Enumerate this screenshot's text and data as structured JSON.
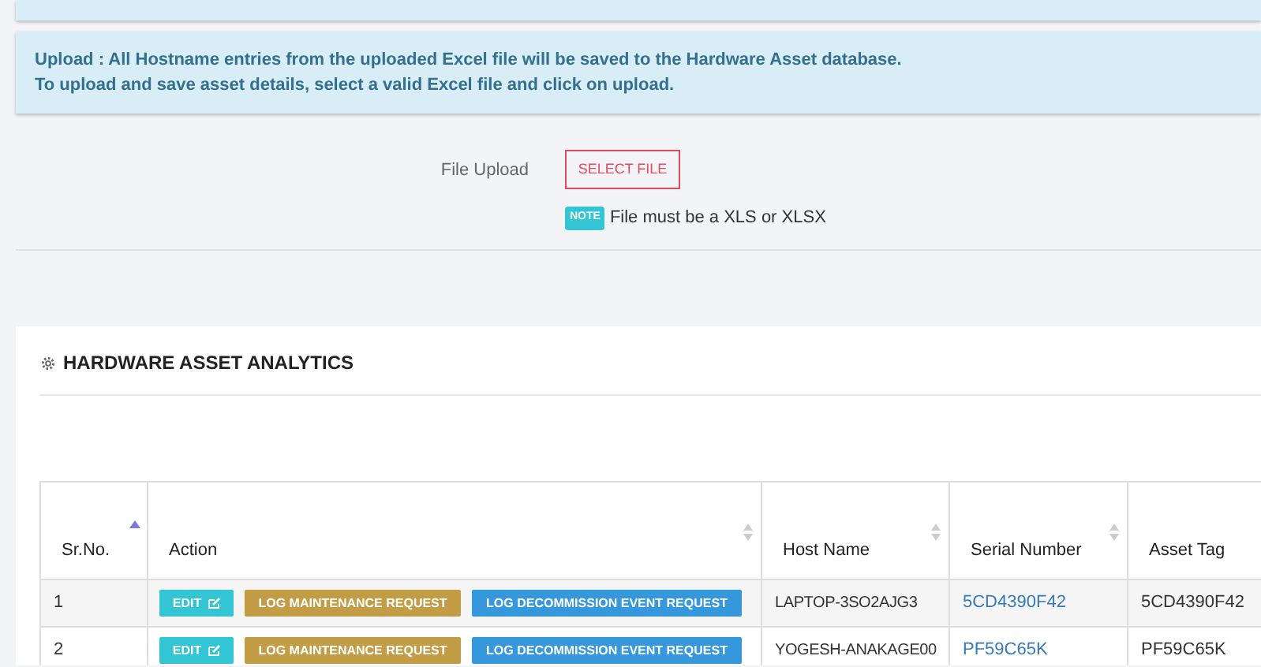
{
  "info": {
    "lines": [
      "Upload : All Hostname entries from the uploaded Excel file will be saved to the Hardware Asset database.",
      "To upload and save asset details, select a valid Excel file and click on upload."
    ]
  },
  "upload": {
    "label": "File Upload",
    "button": "SELECT FILE",
    "note_badge": "NOTE",
    "note": "File must be a XLS or XLSX"
  },
  "card": {
    "title": "HARDWARE ASSET ANALYTICS"
  },
  "table": {
    "columns": [
      {
        "label": "Sr.No.",
        "sorted": true
      },
      {
        "label": "Action",
        "sorted": false
      },
      {
        "label": "Host Name",
        "sorted": false
      },
      {
        "label": "Serial Number",
        "sorted": false
      },
      {
        "label": "Asset Tag"
      }
    ],
    "rows": [
      {
        "sr": "1",
        "actions": [
          {
            "kind": "edit",
            "label": "EDIT"
          },
          {
            "kind": "maintenance",
            "label": "LOG MAINTENANCE REQUEST"
          },
          {
            "kind": "decommission",
            "label": "LOG DECOMMISSION EVENT REQUEST"
          }
        ],
        "host": "LAPTOP-3SO2AJG3",
        "serial": "5CD4390F42",
        "asset_tag": "5CD4390F42"
      },
      {
        "sr": "2",
        "actions": [
          {
            "kind": "edit",
            "label": "EDIT"
          },
          {
            "kind": "maintenance",
            "label": "LOG MAINTENANCE REQUEST"
          },
          {
            "kind": "decommission",
            "label": "LOG DECOMMISSION EVENT REQUEST"
          }
        ],
        "host": "YOGESH-ANAKAGE00",
        "serial": "PF59C65K",
        "asset_tag": "PF59C65K"
      }
    ]
  }
}
